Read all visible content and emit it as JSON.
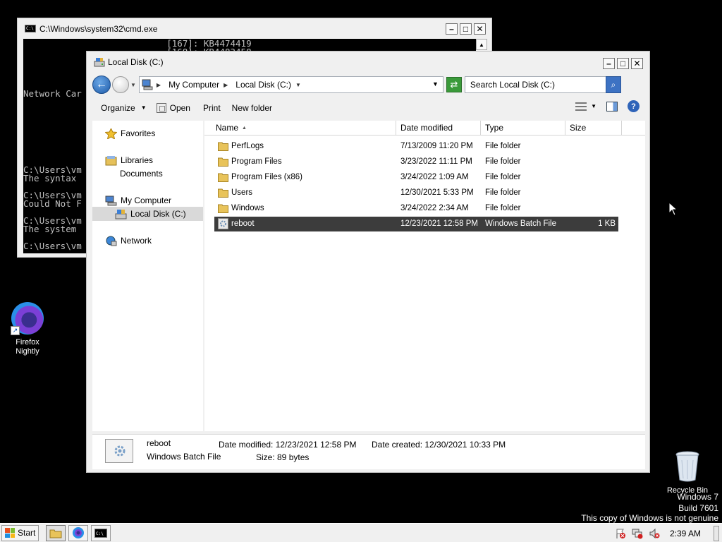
{
  "cmd": {
    "title": "C:\\Windows\\system32\\cmd.exe",
    "lines": [
      "                           [167]: KB4474419",
      "                           [168]: KB4483458",
      "Network Car",
      "C:\\Users\\vm",
      "The syntax ",
      "C:\\Users\\vm",
      "Could Not F",
      "C:\\Users\\vm",
      "The system ",
      "C:\\Users\\vm"
    ]
  },
  "explorer": {
    "title": "Local Disk (C:)",
    "address": {
      "crumbs": [
        "My Computer",
        "Local Disk (C:)"
      ]
    },
    "search_placeholder": "Search Local Disk (C:)",
    "toolbar": {
      "organize": "Organize",
      "open": "Open",
      "print": "Print",
      "new_folder": "New folder"
    },
    "nav": {
      "favorites": "Favorites",
      "libraries": "Libraries",
      "documents": "Documents",
      "my_computer": "My Computer",
      "local_disk": "Local Disk (C:)",
      "network": "Network"
    },
    "columns": {
      "name": "Name",
      "date": "Date modified",
      "type": "Type",
      "size": "Size"
    },
    "files": [
      {
        "name": "PerfLogs",
        "date": "7/13/2009 11:20 PM",
        "type": "File folder",
        "size": "",
        "kind": "folder"
      },
      {
        "name": "Program Files",
        "date": "3/23/2022 11:11 PM",
        "type": "File folder",
        "size": "",
        "kind": "folder"
      },
      {
        "name": "Program Files (x86)",
        "date": "3/24/2022 1:09 AM",
        "type": "File folder",
        "size": "",
        "kind": "folder"
      },
      {
        "name": "Users",
        "date": "12/30/2021 5:33 PM",
        "type": "File folder",
        "size": "",
        "kind": "folder"
      },
      {
        "name": "Windows",
        "date": "3/24/2022 2:34 AM",
        "type": "File folder",
        "size": "",
        "kind": "folder"
      },
      {
        "name": "reboot",
        "date": "12/23/2021 12:58 PM",
        "type": "Windows Batch File",
        "size": "1 KB",
        "kind": "batch",
        "selected": true
      }
    ],
    "details": {
      "name": "reboot",
      "type": "Windows Batch File",
      "date_modified": "Date modified: 12/23/2021 12:58 PM",
      "date_created": "Date created: 12/30/2021 10:33 PM",
      "size": "Size: 89 bytes"
    }
  },
  "desktop": {
    "firefox_label_1": "Firefox",
    "firefox_label_2": "Nightly",
    "recycle_bin": "Recycle Bin",
    "watermark": {
      "line1": "Windows 7",
      "line2": "Build 7601",
      "line3": "This copy of Windows is not genuine"
    }
  },
  "taskbar": {
    "start": "Start",
    "clock": "2:39 AM"
  },
  "colors": {
    "selection": "#3c3c3c",
    "accent_blue": "#1d5aa8"
  }
}
